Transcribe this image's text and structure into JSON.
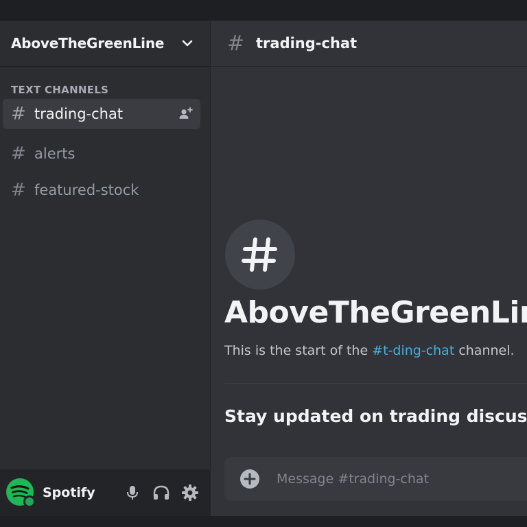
{
  "server": {
    "name": "AboveTheGreenLine"
  },
  "sidebar": {
    "category": "TEXT CHANNELS",
    "channels": [
      {
        "hash": "#",
        "name": "trading-chat",
        "active": true
      },
      {
        "hash": "#",
        "name": "alerts",
        "active": false
      },
      {
        "hash": "#",
        "name": "featured-stock",
        "active": false
      }
    ]
  },
  "user_panel": {
    "name": "Spotify",
    "icons": [
      "spotify-logo",
      "microphone-icon",
      "headphones-icon",
      "gear-icon"
    ]
  },
  "channel_header": {
    "hash": "#",
    "title": "trading-chat"
  },
  "welcome": {
    "icon_glyph": "#",
    "title": "AboveTheGreenLine",
    "subtitle_prefix": "This is the start of the ",
    "subtitle_link": "#t-ding-chat",
    "subtitle_suffix": " channel."
  },
  "topic": "Stay updated on trading discussions",
  "composer": {
    "placeholder": "Message #trading-chat"
  },
  "colors": {
    "background": "#313338",
    "sidebar": "#2b2d31",
    "user_panel": "#232428",
    "link": "#3fb3e6",
    "spotify_green": "#1db954"
  }
}
